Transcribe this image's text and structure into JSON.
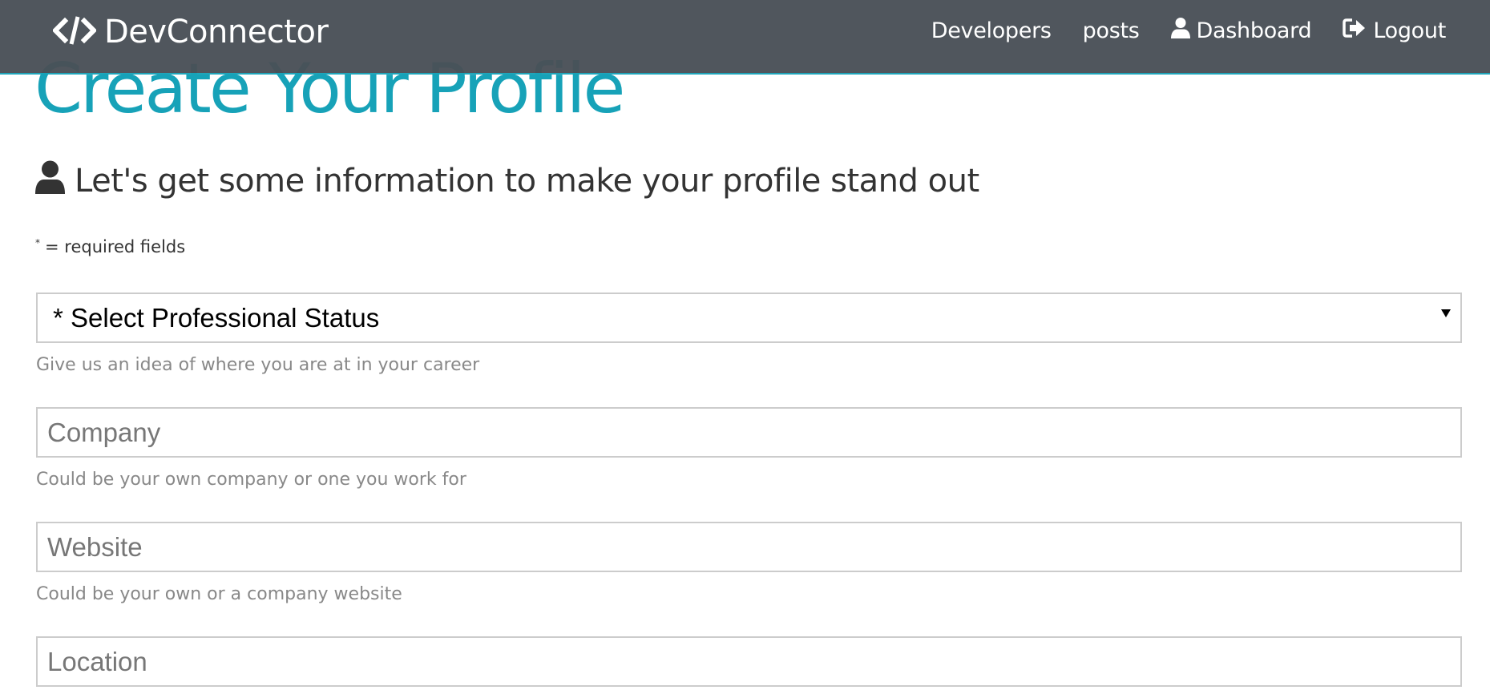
{
  "navbar": {
    "brand": "DevConnector",
    "links": [
      {
        "label": "Developers",
        "icon": ""
      },
      {
        "label": "posts",
        "icon": ""
      },
      {
        "label": "Dashboard",
        "icon": "user-icon"
      },
      {
        "label": "Logout",
        "icon": "sign-out-icon"
      }
    ]
  },
  "page": {
    "title": "Create Your Profile",
    "lead": "Let's get some information to make your profile stand out",
    "required_note": "= required fields",
    "required_star": "*"
  },
  "form": {
    "status_select": {
      "selected": "* Select Professional Status",
      "hint": "Give us an idea of where you are at in your career"
    },
    "company": {
      "value": "",
      "placeholder": "Company",
      "hint": "Could be your own company or one you work for"
    },
    "website": {
      "value": "",
      "placeholder": "Website",
      "hint": "Could be your own or a company website"
    },
    "location": {
      "value": "",
      "placeholder": "Location"
    }
  },
  "colors": {
    "navbar_bg": "#495057",
    "primary": "#17a2b8",
    "text": "#333333",
    "hint": "#888888"
  }
}
